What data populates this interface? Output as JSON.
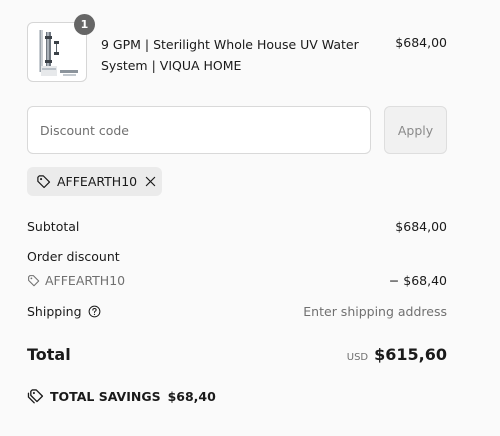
{
  "product": {
    "quantity": "1",
    "title": "9 GPM | Sterilight Whole House UV Water System | VIQUA HOME",
    "price": "$684,00"
  },
  "discount": {
    "placeholder": "Discount code",
    "apply_label": "Apply",
    "applied_code": "AFFEARTH10"
  },
  "summary": {
    "subtotal_label": "Subtotal",
    "subtotal_value": "$684,00",
    "order_discount_label": "Order discount",
    "discount_code": "AFFEARTH10",
    "discount_value": "− $68,40",
    "shipping_label": "Shipping",
    "shipping_value": "Enter shipping address",
    "total_label": "Total",
    "currency": "USD",
    "total_value": "$615,60",
    "savings_label": "TOTAL SAVINGS",
    "savings_value": "$68,40"
  }
}
